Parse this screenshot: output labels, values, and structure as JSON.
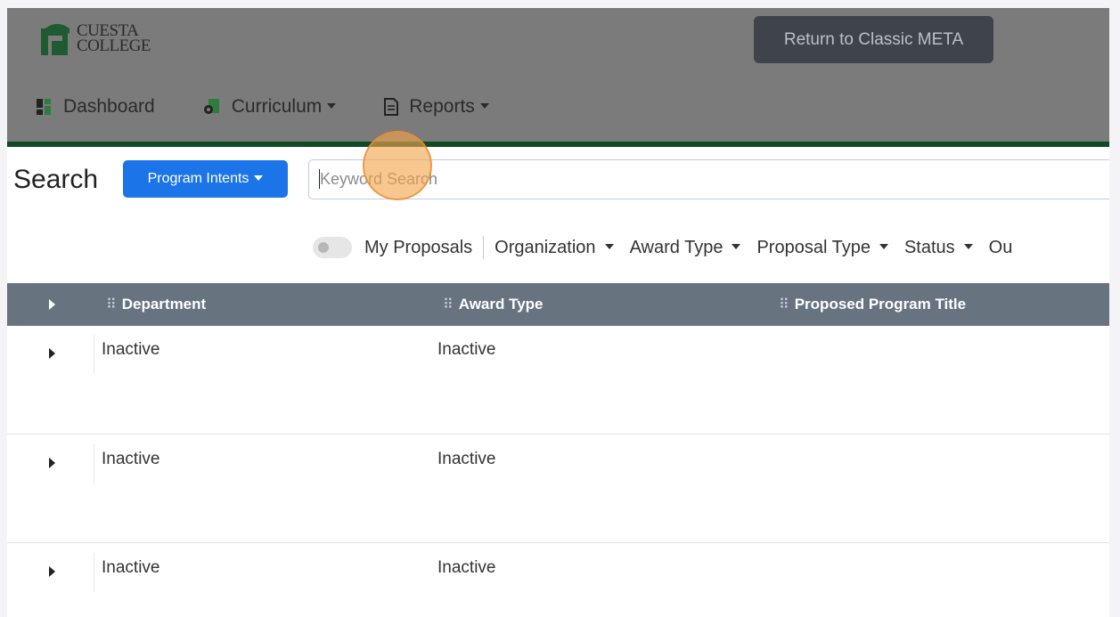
{
  "header": {
    "logo_line1": "CUESTA",
    "logo_line2": "COLLEGE",
    "classic_button": "Return to Classic META",
    "nav": [
      {
        "label": "Dashboard",
        "icon": "dashboard-icon",
        "dropdown": false
      },
      {
        "label": "Curriculum",
        "icon": "curriculum-icon",
        "dropdown": true
      },
      {
        "label": "Reports",
        "icon": "reports-icon",
        "dropdown": true
      }
    ]
  },
  "search": {
    "title": "Search",
    "type_button": "Program Intents",
    "placeholder": "Keyword Search"
  },
  "filters": {
    "my_proposals": "My Proposals",
    "items": [
      "Organization",
      "Award Type",
      "Proposal Type",
      "Status",
      "Ou"
    ]
  },
  "table": {
    "columns": [
      "Department",
      "Award Type",
      "Proposed Program Title"
    ],
    "rows": [
      {
        "department": "Inactive",
        "award_type": "Inactive",
        "title": ""
      },
      {
        "department": "Inactive",
        "award_type": "Inactive",
        "title": ""
      },
      {
        "department": "Inactive",
        "award_type": "Inactive",
        "title": ""
      }
    ]
  },
  "colors": {
    "header_bg": "#7b7b7b",
    "accent_green": "#0f4a26",
    "primary_blue": "#1b74e8",
    "table_header": "#687380"
  }
}
